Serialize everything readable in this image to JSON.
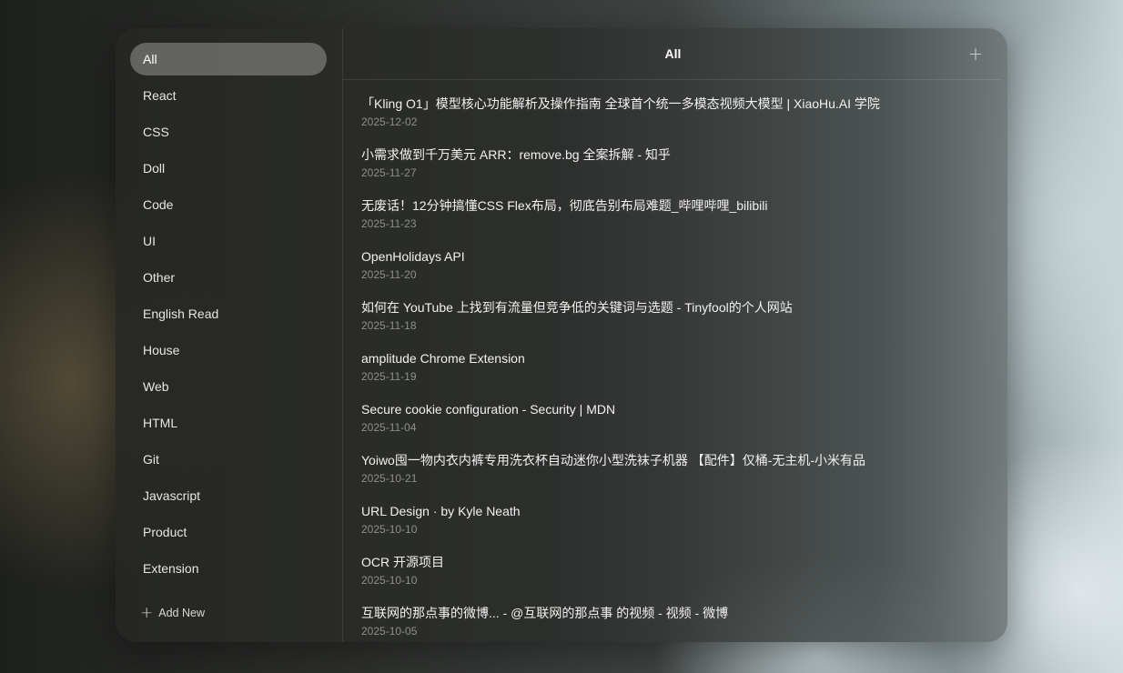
{
  "sidebar": {
    "categories": [
      {
        "label": "All",
        "active": true
      },
      {
        "label": "React"
      },
      {
        "label": "CSS"
      },
      {
        "label": "Doll"
      },
      {
        "label": "Code"
      },
      {
        "label": "UI"
      },
      {
        "label": "Other"
      },
      {
        "label": "English Read"
      },
      {
        "label": "House"
      },
      {
        "label": "Web"
      },
      {
        "label": "HTML"
      },
      {
        "label": "Git"
      },
      {
        "label": "Javascript"
      },
      {
        "label": "Product"
      },
      {
        "label": "Extension"
      }
    ],
    "add_new_label": "Add New",
    "add_new_icon": "plus-icon"
  },
  "header": {
    "title": "All",
    "add_icon": "plus-icon"
  },
  "bookmarks": [
    {
      "title": "「Kling O1」模型核心功能解析及操作指南 全球首个统一多模态视频大模型 | XiaoHu.AI 学院",
      "date": "2025-12-02"
    },
    {
      "title": "小需求做到千万美元 ARR：remove.bg 全案拆解 - 知乎",
      "date": "2025-11-27"
    },
    {
      "title": "无废话！12分钟搞懂CSS Flex布局，彻底告别布局难题_哔哩哔哩_bilibili",
      "date": "2025-11-23"
    },
    {
      "title": "OpenHolidays API",
      "date": "2025-11-20"
    },
    {
      "title": "如何在 YouTube 上找到有流量但竞争低的关键词与选题 - Tinyfool的个人网站",
      "date": "2025-11-18"
    },
    {
      "title": "amplitude Chrome Extension",
      "date": "2025-11-19"
    },
    {
      "title": "Secure cookie configuration - Security | MDN",
      "date": "2025-11-04"
    },
    {
      "title": "Yoiwo囤一物内衣内裤专用洗衣杯自动迷你小型洗袜子机器 【配件】仅桶-无主机-小米有品",
      "date": "2025-10-21"
    },
    {
      "title": "URL Design · by Kyle Neath",
      "date": "2025-10-10"
    },
    {
      "title": "OCR 开源项目",
      "date": "2025-10-10"
    },
    {
      "title": "互联网的那点事的微博... - @互联网的那点事 的视频 - 视频 - 微博",
      "date": "2025-10-05"
    }
  ],
  "colors": {
    "active_category_bg": "#8f8f8b",
    "text_primary": "#f2f2f0",
    "text_date": "#8d8f8c"
  }
}
